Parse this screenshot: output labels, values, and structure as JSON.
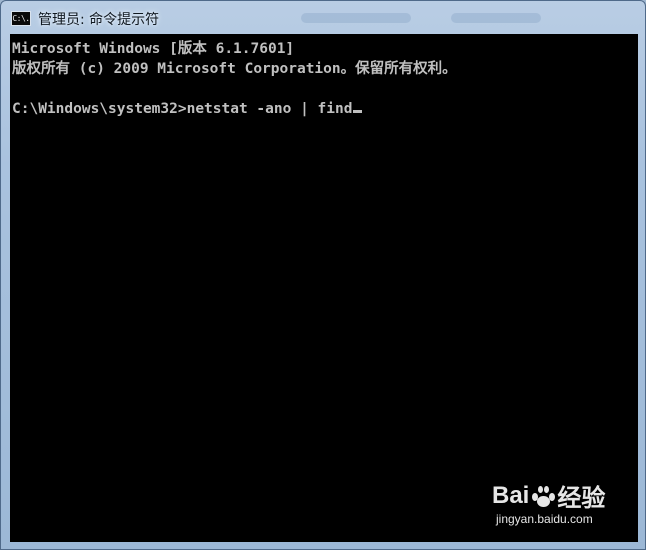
{
  "window": {
    "title": "管理员: 命令提示符",
    "icon": "cmd-icon",
    "icon_label": "C:\\."
  },
  "console": {
    "lines": [
      "Microsoft Windows [版本 6.1.7601]",
      "版权所有 (c) 2009 Microsoft Corporation。保留所有权利。",
      "",
      "C:\\Windows\\system32>netstat -ano | find"
    ],
    "text_color": "#c0c0c0",
    "background": "#000000"
  },
  "watermark": {
    "brand_left": "Bai",
    "brand_right": "经验",
    "url": "jingyan.baidu.com"
  }
}
